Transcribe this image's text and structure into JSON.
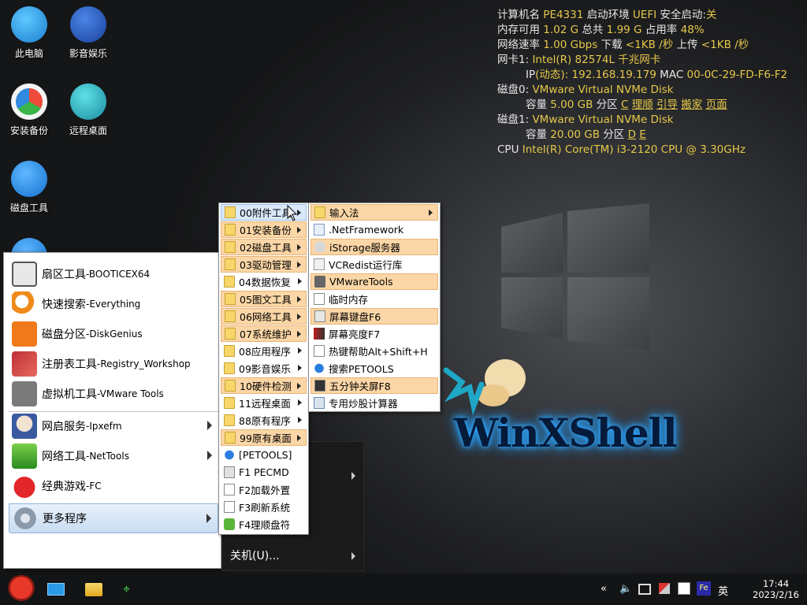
{
  "desktop": {
    "icons": [
      {
        "label": "此电脑"
      },
      {
        "label": "影音娱乐"
      },
      {
        "label": "安装备份"
      },
      {
        "label": "远程桌面"
      },
      {
        "label": "磁盘工具"
      }
    ]
  },
  "sysinfo": {
    "l1": {
      "k1": "计算机名",
      "v1": "PE4331",
      "k2": "启动环境",
      "v2": "UEFI",
      "k3": "安全启动:",
      "v3": "关"
    },
    "l2": {
      "k1": "内存可用",
      "v1": "1.02 G",
      "k2": "总共",
      "v2": "1.99 G",
      "k3": "占用率",
      "v3": "48%"
    },
    "l3": {
      "k1": "网络速率",
      "v1": "1.00 Gbps",
      "k2": "下载",
      "v2": "<1KB /秒",
      "k3": "上传",
      "v3": "<1KB /秒"
    },
    "l4": {
      "k1": "网卡1:",
      "v1": "Intel(R) 82574L 千兆网卡"
    },
    "l5": {
      "k1": "IP",
      "v1": "(动态):",
      "v2": "192.168.19.179",
      "k2": "MAC",
      "v3": "00-0C-29-FD-F6-F2"
    },
    "l6": {
      "k1": "磁盘0:",
      "v1": "VMware Virtual NVMe Disk"
    },
    "l7": {
      "k1": "容量",
      "v1": "5.00 GB",
      "k2": "分区",
      "p1": "C",
      "a1": "理顺",
      "a2": "引导",
      "a3": "搬家",
      "a4": "页面"
    },
    "l8": {
      "k1": "磁盘1:",
      "v1": "VMware Virtual NVMe Disk"
    },
    "l9": {
      "k1": "容量",
      "v1": "20.00 GB",
      "k2": "分区",
      "p1": "D",
      "p2": "E"
    },
    "l10": {
      "k1": "CPU",
      "v1": "Intel(R) Core(TM) i3-2120 CPU @ 3.30GHz"
    }
  },
  "brand": "WinXShell",
  "startmenu": {
    "items": [
      {
        "label": "扇区工具",
        "sub": "-BOOTICEX64"
      },
      {
        "label": "快速搜索",
        "sub": "-Everything"
      },
      {
        "label": "磁盘分区",
        "sub": "-DiskGenius"
      },
      {
        "label": "注册表工具",
        "sub": "-Registry_Workshop"
      },
      {
        "label": "虚拟机工具",
        "sub": "-VMware Tools"
      },
      {
        "label": "网启服务",
        "sub": "-Ipxefm"
      },
      {
        "label": "网络工具",
        "sub": "-NetTools"
      },
      {
        "label": "经典游戏",
        "sub": "-FC"
      },
      {
        "label": "更多程序",
        "sub": ""
      }
    ],
    "shutdown": "关机(U)..."
  },
  "programs": {
    "items": [
      "00附件工具",
      "01安装备份",
      "02磁盘工具",
      "03驱动管理",
      "04数据恢复",
      "05图文工具",
      "06网络工具",
      "07系统维护",
      "08应用程序",
      "09影音娱乐",
      "10硬件检测",
      "11远程桌面",
      "88原有程序",
      "99原有桌面",
      "[PETOOLS]",
      "F1 PECMD",
      "F2加载外置",
      "F3刷新系统",
      "F4理顺盘符"
    ]
  },
  "accessories": {
    "items": [
      "输入法",
      ".NetFramework",
      "iStorage服务器",
      "VCRedist运行库",
      "VMwareTools",
      "临时内存",
      "屏幕键盘F6",
      "屏幕亮度F7",
      "热键帮助Alt+Shift+H",
      "搜索PETOOLS",
      "五分钟关屏F8",
      "专用炒股计算器"
    ]
  },
  "taskbar": {
    "tray_ime": "英",
    "time": "17:44",
    "date": "2023/2/16"
  },
  "colors": {
    "accent_yellow": "#e6c84a",
    "menu_orange": "#fbd6a6",
    "menu_highlight": "#d9e8fa"
  }
}
